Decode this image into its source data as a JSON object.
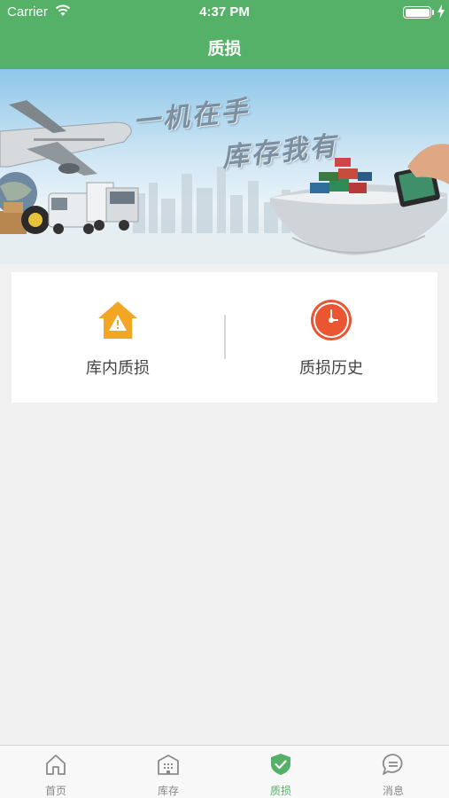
{
  "status_bar": {
    "carrier": "Carrier",
    "time": "4:37 PM"
  },
  "header": {
    "title": "质损"
  },
  "banner": {
    "slogan_line1": "一机在手",
    "slogan_line2": "库存我有"
  },
  "menu": {
    "items": [
      {
        "label": "库内质损",
        "icon": "warehouse-warning-icon",
        "color": "#f2a623"
      },
      {
        "label": "质损历史",
        "icon": "clock-icon",
        "color": "#ea5532"
      }
    ]
  },
  "tabbar": {
    "active_color": "#55b168",
    "items": [
      {
        "label": "首页",
        "icon": "home-icon"
      },
      {
        "label": "库存",
        "icon": "building-icon"
      },
      {
        "label": "质损",
        "icon": "shield-check-icon",
        "active": true
      },
      {
        "label": "消息",
        "icon": "chat-bubble-icon"
      }
    ]
  }
}
